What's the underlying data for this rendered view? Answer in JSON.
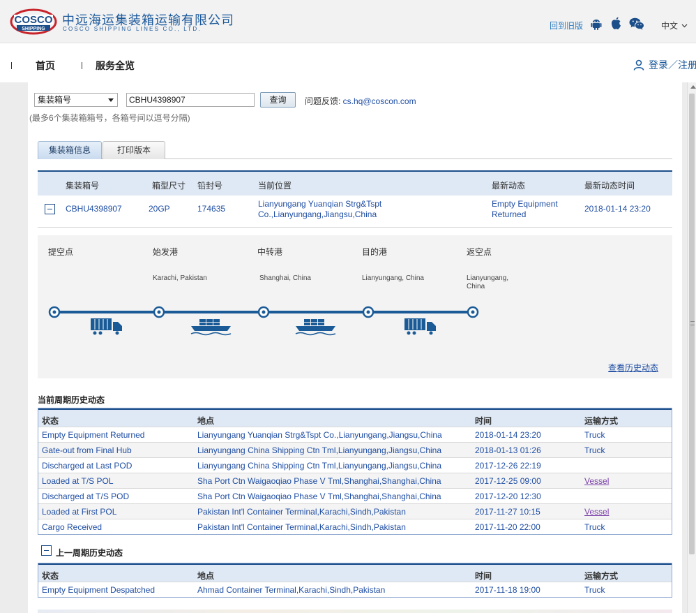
{
  "header": {
    "logo_text_top": "COSCO",
    "logo_text_bottom": "SHIPPING",
    "brand_cn": "中远海运集装箱运输有限公司",
    "brand_en": "COSCO SHIPPING LINES CO., LTD.",
    "old_version": "回到旧版",
    "language": "中文",
    "icons": [
      "android-icon",
      "apple-icon",
      "wechat-icon"
    ]
  },
  "nav": {
    "home": "首页",
    "services": "服务全览",
    "login": "登录／注册"
  },
  "search": {
    "type_selected": "集装箱号",
    "query": "CBHU4398907",
    "button": "查询",
    "feedback_label": "问题反馈: ",
    "feedback_email": "cs.hq@coscon.com",
    "hint": "(最多6个集装箱箱号，各箱号间以逗号分隔)"
  },
  "tabs": [
    "集装箱信息",
    "打印版本"
  ],
  "container": {
    "headers": [
      "集装箱号",
      "箱型尺寸",
      "铅封号",
      "当前位置",
      "最新动态",
      "最新动态时间"
    ],
    "row": {
      "number": "CBHU4398907",
      "size": "20GP",
      "seal": "174635",
      "location_line1": "Lianyungang Yuanqian Strg&Tspt",
      "location_line2": "Co.,Lianyungang,Jiangsu,China",
      "status_line1": "Empty Equipment",
      "status_line2": "Returned",
      "time": "2018-01-14 23:20"
    }
  },
  "route": {
    "stops": [
      {
        "label": "提空点",
        "place1": "",
        "place2": ""
      },
      {
        "label": "始发港",
        "place1": "Karachi, Pakistan",
        "place2": ""
      },
      {
        "label": "中转港",
        "place1": "Shanghai, China",
        "place2": ""
      },
      {
        "label": "目的港",
        "place1": "Lianyungang, China",
        "place2": ""
      },
      {
        "label": "返空点",
        "place1": "Lianyungang,",
        "place2": "China"
      }
    ],
    "legs": [
      "truck",
      "vessel",
      "vessel",
      "truck"
    ],
    "history_link": "查看历史动态",
    "line_color": "#1a5a96"
  },
  "current_history": {
    "title": "当前周期历史动态",
    "headers": [
      "状态",
      "地点",
      "时间",
      "运输方式"
    ],
    "rows": [
      [
        "Empty Equipment Returned",
        "Lianyungang Yuanqian Strg&Tspt Co.,Lianyungang,Jiangsu,China",
        "2018-01-14 23:20",
        "Truck"
      ],
      [
        "Gate-out from Final Hub",
        "Lianyungang China Shipping Ctn Tml,Lianyungang,Jiangsu,China",
        "2018-01-13 01:26",
        "Truck"
      ],
      [
        "Discharged at Last POD",
        "Lianyungang China Shipping Ctn Tml,Lianyungang,Jiangsu,China",
        "2017-12-26 22:19",
        ""
      ],
      [
        "Loaded at T/S POL",
        "Sha Port Ctn Waigaoqiao Phase V Tml,Shanghai,Shanghai,China",
        "2017-12-25 09:00",
        "Vessel"
      ],
      [
        "Discharged at T/S POD",
        "Sha Port Ctn Waigaoqiao Phase V Tml,Shanghai,Shanghai,China",
        "2017-12-20 12:30",
        ""
      ],
      [
        "Loaded at First POL",
        "Pakistan Int'l Container Terminal,Karachi,Sindh,Pakistan",
        "2017-11-27 10:15",
        "Vessel"
      ],
      [
        "Cargo Received",
        "Pakistan Int'l Container Terminal,Karachi,Sindh,Pakistan",
        "2017-11-20 22:00",
        "Truck"
      ]
    ]
  },
  "previous_history": {
    "title": "上一周期历史动态",
    "headers": [
      "状态",
      "地点",
      "时间",
      "运输方式"
    ],
    "rows": [
      [
        "Empty Equipment Despatched",
        "Ahmad Container Terminal,Karachi,Sindh,Pakistan",
        "2017-11-18 19:00",
        "Truck"
      ]
    ]
  }
}
